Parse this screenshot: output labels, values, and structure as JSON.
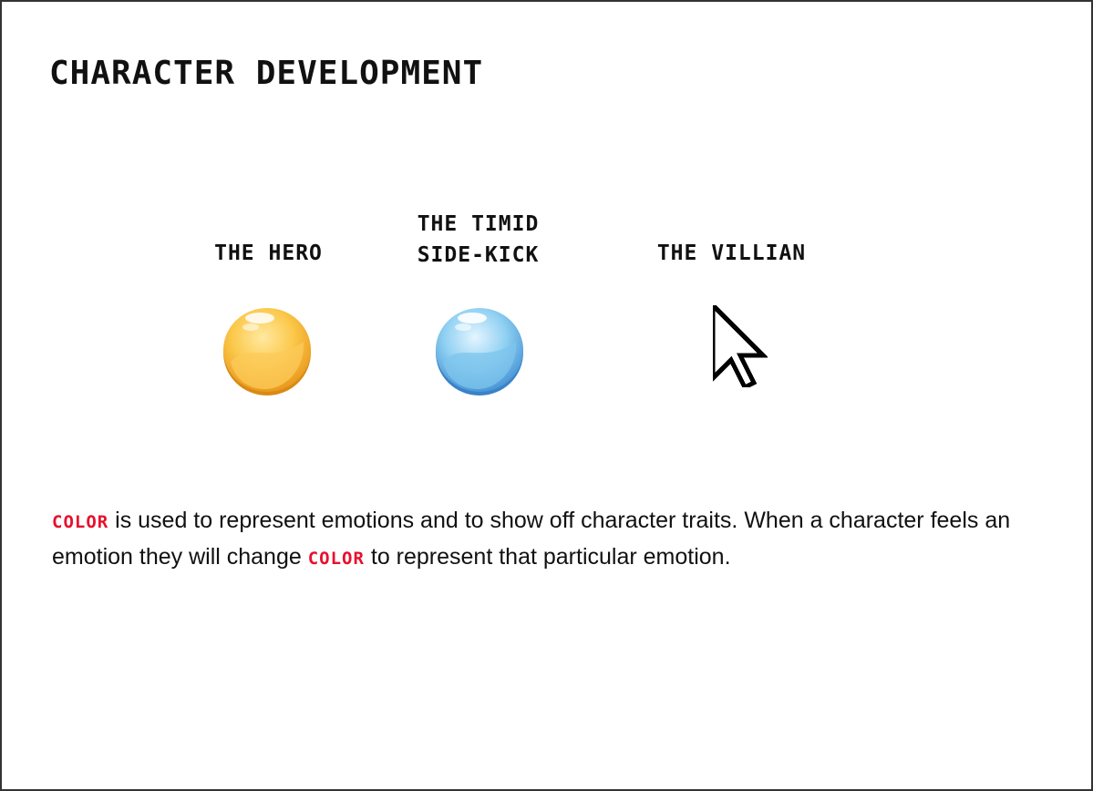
{
  "title": "CHARACTER DEVELOPMENT",
  "characters": [
    {
      "label": "THE HERO",
      "icon": "yellow-orb-icon",
      "color": "#f7c13a"
    },
    {
      "label_line1": "THE TIMID",
      "label_line2": "SIDE-KICK",
      "icon": "blue-orb-icon",
      "color": "#7cc3ea"
    },
    {
      "label": "THE VILLIAN",
      "icon": "mouse-cursor-icon",
      "color": "#000000"
    }
  ],
  "description": {
    "keyword": "COLOR",
    "keyword_color": "#e8102e",
    "part1": " is used to represent emotions and to show off character traits. When a character feels an emotion they will change ",
    "part2": " to represent that particular emotion."
  }
}
